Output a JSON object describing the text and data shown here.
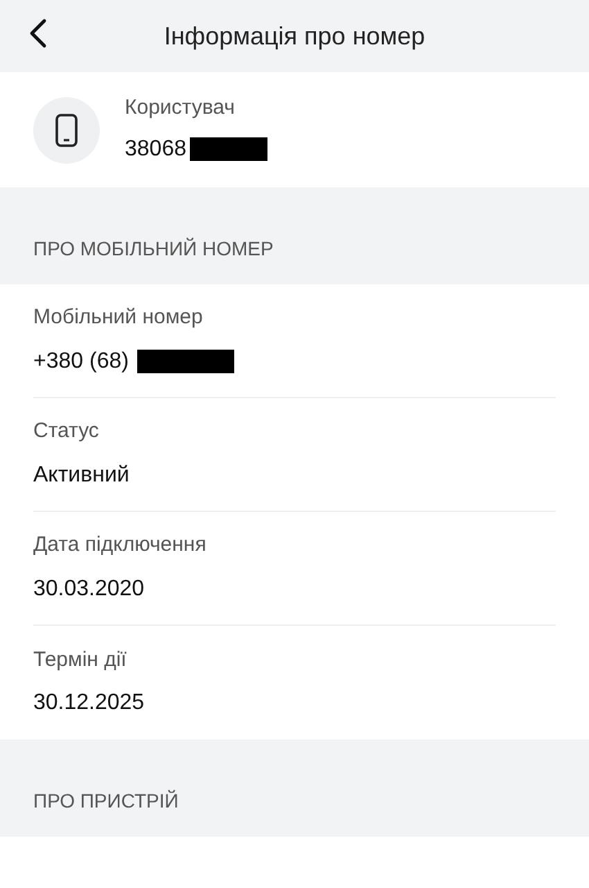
{
  "header": {
    "title": "Інформація про номер"
  },
  "user": {
    "label": "Користувач",
    "value": "38068",
    "redacted": true
  },
  "sections": [
    {
      "title": "ПРО МОБІЛЬНИЙ НОМЕР",
      "rows": [
        {
          "label": "Мобільний номер",
          "value": "+380 (68)",
          "redacted": true
        },
        {
          "label": "Статус",
          "value": "Активний",
          "redacted": false
        },
        {
          "label": "Дата підключення",
          "value": "30.03.2020",
          "redacted": false
        },
        {
          "label": "Термін дії",
          "value": "30.12.2025",
          "redacted": false
        }
      ]
    },
    {
      "title": "ПРО ПРИСТРІЙ"
    }
  ]
}
